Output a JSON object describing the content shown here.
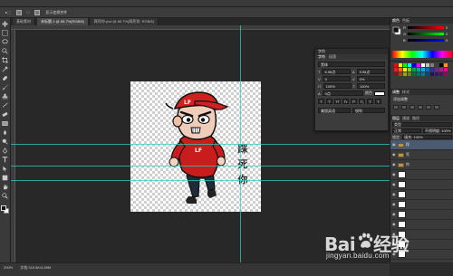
{
  "options_bar": {
    "items": [
      "显示变换控件"
    ]
  },
  "tabs": [
    {
      "label": "基础素材",
      "active": false
    },
    {
      "label": "未标题-1 @ 66.7%(RGB/8)",
      "active": true
    },
    {
      "label": "踩死你.psd @ 66.7%(踩死你, RGB/8)",
      "active": false
    }
  ],
  "canvas": {
    "text": "踩死你",
    "text_color": "#333333",
    "accent": "#cc1f1f"
  },
  "character_panel": {
    "title": "字符",
    "tabs": [
      "字符",
      "段落"
    ],
    "font_family": "黑体",
    "font_size": "6.96点",
    "leading": "9.96点",
    "tracking": "0",
    "kerning": "0%",
    "vscale": "100%",
    "hscale": "100%",
    "baseline": "0点",
    "color_label": "颜色",
    "style_buttons": [
      "T",
      "T",
      "TT",
      "Tr",
      "T¹",
      "T₁",
      "T",
      "T"
    ],
    "language": "美国英语",
    "antialias": "锐利"
  },
  "color_panel": {
    "tabs": [
      "颜色",
      "色板"
    ],
    "sliders": [
      {
        "label": "R",
        "value": "0"
      },
      {
        "label": "G",
        "value": "0"
      },
      {
        "label": "B",
        "value": "0"
      }
    ]
  },
  "adjust_panel": {
    "tabs": [
      "调整",
      "样式"
    ],
    "title": "添加调整"
  },
  "layers_panel": {
    "tabs": [
      "图层",
      "通道",
      "路径"
    ],
    "kind_label": "类型",
    "blend_mode": "正常",
    "opacity": "不透明度: 100%",
    "lock_label": "锁定:",
    "fill": "填充: 100%",
    "layers": [
      {
        "name": "踩",
        "kind": "folder",
        "selected": true
      },
      {
        "name": "死",
        "kind": "folder",
        "selected": false
      },
      {
        "name": "你",
        "kind": "folder",
        "selected": false
      },
      {
        "name": "",
        "kind": "thumb",
        "selected": false
      },
      {
        "name": "",
        "kind": "thumb",
        "selected": false
      },
      {
        "name": "",
        "kind": "thumb",
        "selected": false
      },
      {
        "name": "",
        "kind": "thumb",
        "selected": false
      },
      {
        "name": "",
        "kind": "thumb",
        "selected": false
      },
      {
        "name": "",
        "kind": "thumb",
        "selected": false
      },
      {
        "name": "",
        "kind": "thumb",
        "selected": false
      },
      {
        "name": "",
        "kind": "thumb",
        "selected": false
      },
      {
        "name": "",
        "kind": "thumb",
        "selected": false
      }
    ]
  },
  "status_bar": {
    "zoom": "200%",
    "doc_info": "文档:316.5K/4.89M"
  },
  "watermark": {
    "brand_left": "Bai",
    "brand_right": "经验",
    "url": "jingyan.baidu.com"
  }
}
